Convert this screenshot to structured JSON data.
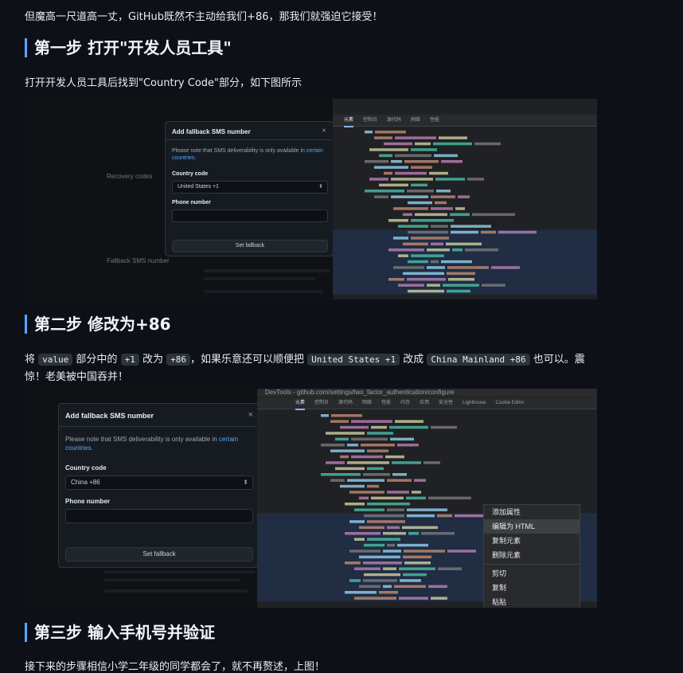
{
  "intro": "但魔高一尺道高一丈，GitHub既然不主动给我们+86，那我们就强迫它接受！",
  "step1": {
    "heading": "第一步 打开\"开发人员工具\"",
    "desc": "打开开发人员工具后找到\"Country Code\"部分，如下图所示"
  },
  "step2": {
    "heading": "第二步 修改为+86",
    "desc_prefix": "将",
    "code1": "value",
    "desc_mid1": "部分中的",
    "code2": "+1",
    "desc_mid2": "改为",
    "code3": "+86",
    "desc_mid3": "，如果乐意还可以顺便把",
    "code4": "United States +1",
    "desc_mid4": "改成",
    "code5": "China Mainland +86",
    "desc_mid5": "也可以。震",
    "desc_line2": "惊！老美被中国吞并！"
  },
  "step3": {
    "heading": "第三步 输入手机号并验证",
    "desc": "接下来的步骤相信小学二年级的同学都会了，就不再赘述，上图！"
  },
  "shot1": {
    "modal_title": "Add fallback SMS number",
    "close": "×",
    "note_text": "Please note that SMS deliverability is only available in ",
    "note_link": "certain countries.",
    "country_label": "Country code",
    "country_value": "United States +1",
    "phone_label": "Phone number",
    "button": "Set fallback",
    "bg_label": "Recovery codes",
    "bg_label2": "Fallback SMS number"
  },
  "shot2": {
    "modal_title": "Add fallback SMS number",
    "close": "×",
    "note_text": "Please note that SMS deliverability is only available in ",
    "note_link": "certain countries.",
    "country_label": "Country code",
    "country_value": "China +86",
    "phone_label": "Phone number",
    "button": "Set fallback",
    "devtools_title": "DevTools - github.com/settings/two_factor_authentication/configure",
    "tabs": [
      "元素",
      "控制台",
      "源代码",
      "网络",
      "性能",
      "内存",
      "应用",
      "安全性",
      "Lighthouse",
      "Cookie Editor"
    ],
    "context_menu": [
      "添加属性",
      "编辑为 HTML",
      "复制元素",
      "删除元素",
      "剪切",
      "复制",
      "粘贴"
    ]
  },
  "colors": {
    "accent": "#58a6ff",
    "bg": "#0d1117"
  }
}
